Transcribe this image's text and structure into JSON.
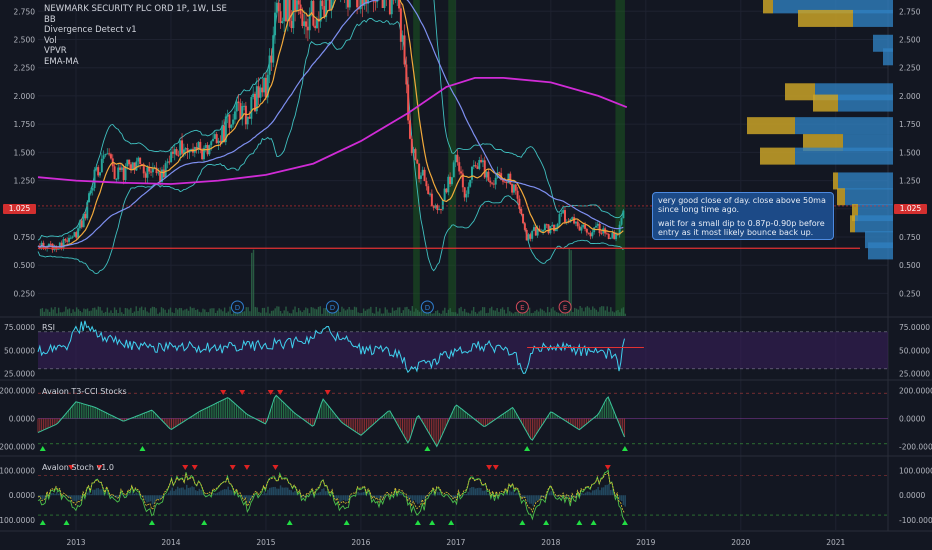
{
  "legend": {
    "symbol": "NEWMARK SECURITY PLC ORD 1P, 1W, LSE",
    "indicators": [
      "BB",
      "Divergence Detect v1",
      "Vol",
      "VPVR",
      "EMA-MA"
    ]
  },
  "annotation": {
    "line1": "very good close of day. close above 50ma since long time ago.",
    "line2": "wait for a small dip to 0.87p-0.90p before entry as it most likely bounce back up."
  },
  "current_price_label": "1.025",
  "colors": {
    "background": "#131722",
    "candle_up": "#26a69a",
    "candle_down": "#ef5350",
    "ma200": "#d02bd6",
    "ema_orange": "#f2a93b",
    "ma_blue": "#7e8ff0",
    "bollinger": "#3fbfbf",
    "support_line": "#e23232",
    "rsi_line": "#3fd0ee",
    "vpvr_up": "#2f7fbf",
    "vpvr_down": "#c9a227"
  },
  "panes": {
    "rsi_label": "RSI",
    "cci_label": "Avalon T3-CCI Stocks",
    "stoch_label": "Avalon Stoch v1.0"
  },
  "chart_data": [
    {
      "type": "candlestick",
      "title": "NEWMARK SECURITY PLC ORD 1P, 1W, LSE",
      "x_axis": {
        "tick_labels": [
          "2013",
          "2014",
          "2015",
          "2016",
          "2017",
          "2018",
          "2019",
          "2020",
          "2021"
        ]
      },
      "y_axis": {
        "tick_labels": [
          "0.250",
          "0.500",
          "0.750",
          "1.000",
          "1.250",
          "1.500",
          "1.750",
          "2.000",
          "2.250",
          "2.500",
          "2.750"
        ],
        "range": [
          0.05,
          2.85
        ]
      },
      "current_price": 1.025,
      "support_level": 0.65,
      "price_path": {
        "x": [
          2012.6,
          2012.75,
          2012.9,
          2013.0,
          2013.1,
          2013.2,
          2013.3,
          2013.45,
          2013.6,
          2013.75,
          2013.9,
          2014.0,
          2014.1,
          2014.2,
          2014.35,
          2014.5,
          2014.6,
          2014.7,
          2014.8,
          2014.9,
          2015.0,
          2015.05,
          2015.1,
          2015.2,
          2015.3,
          2015.4,
          2015.5,
          2015.6,
          2015.7,
          2015.8,
          2015.9,
          2016.0,
          2016.1,
          2016.2,
          2016.3,
          2016.4,
          2016.45,
          2016.5,
          2016.6,
          2016.7,
          2016.8,
          2016.9,
          2017.0,
          2017.1,
          2017.2,
          2017.3,
          2017.4,
          2017.5,
          2017.6,
          2017.7,
          2017.75,
          2017.8,
          2017.9,
          2018.0,
          2018.1,
          2018.2,
          2018.3,
          2018.4,
          2018.5,
          2018.6,
          2018.7,
          2018.78
        ],
        "y": [
          0.68,
          0.66,
          0.7,
          0.78,
          0.95,
          1.3,
          1.45,
          1.3,
          1.4,
          1.35,
          1.3,
          1.5,
          1.55,
          1.48,
          1.52,
          1.6,
          1.75,
          1.85,
          1.8,
          2.0,
          2.05,
          2.3,
          2.7,
          2.8,
          2.75,
          2.6,
          2.75,
          2.8,
          2.95,
          3.0,
          2.9,
          2.95,
          3.0,
          2.95,
          2.85,
          2.75,
          2.4,
          1.7,
          1.35,
          1.2,
          0.95,
          1.15,
          1.5,
          1.1,
          1.4,
          1.35,
          1.25,
          1.3,
          1.2,
          0.9,
          0.75,
          0.78,
          0.85,
          0.8,
          0.95,
          0.9,
          0.85,
          0.8,
          0.82,
          0.78,
          0.75,
          1.025
        ]
      },
      "ma200": {
        "x": [
          2012.6,
          2013.0,
          2013.5,
          2014.0,
          2014.5,
          2015.0,
          2015.5,
          2016.0,
          2016.5,
          2016.9,
          2017.2,
          2017.5,
          2018.0,
          2018.5,
          2018.8
        ],
        "y": [
          1.28,
          1.25,
          1.23,
          1.22,
          1.25,
          1.3,
          1.4,
          1.6,
          1.85,
          2.08,
          2.16,
          2.16,
          2.12,
          2.0,
          1.9
        ]
      },
      "divergence_markers": [
        {
          "label": "D",
          "x": 2014.7
        },
        {
          "label": "D",
          "x": 2015.7
        },
        {
          "label": "D",
          "x": 2016.7
        },
        {
          "label": "E",
          "x": 2017.7
        },
        {
          "label": "E",
          "x": 2018.15
        }
      ]
    },
    {
      "type": "line",
      "title": "RSI",
      "y_axis": {
        "tick_labels": [
          "25.0000",
          "50.0000",
          "75.0000"
        ],
        "range": [
          20,
          85
        ]
      },
      "bands": [
        30,
        70
      ],
      "x": [
        2012.6,
        2012.9,
        2013.0,
        2013.1,
        2013.3,
        2013.5,
        2013.8,
        2014.0,
        2014.5,
        2015.0,
        2015.3,
        2015.5,
        2015.6,
        2016.0,
        2016.4,
        2016.5,
        2016.7,
        2016.9,
        2017.0,
        2017.3,
        2017.6,
        2017.7,
        2017.75,
        2017.8,
        2018.0,
        2018.3,
        2018.5,
        2018.7,
        2018.72,
        2018.78
      ],
      "y": [
        50,
        52,
        72,
        78,
        65,
        58,
        52,
        55,
        52,
        56,
        58,
        62,
        75,
        50,
        48,
        30,
        35,
        45,
        50,
        55,
        50,
        28,
        32,
        50,
        55,
        50,
        48,
        45,
        30,
        72
      ]
    },
    {
      "type": "line",
      "title": "Avalon T3-CCI Stocks",
      "y_axis": {
        "tick_labels": [
          "-200.0000",
          "0.0000",
          "200.0000"
        ],
        "range": [
          -260,
          260
        ]
      },
      "x": [
        2012.6,
        2012.8,
        2013.0,
        2013.2,
        2013.5,
        2013.8,
        2014.0,
        2014.3,
        2014.6,
        2014.8,
        2015.0,
        2015.1,
        2015.3,
        2015.5,
        2015.6,
        2015.8,
        2016.0,
        2016.3,
        2016.5,
        2016.6,
        2016.8,
        2017.0,
        2017.3,
        2017.6,
        2017.8,
        2018.0,
        2018.3,
        2018.5,
        2018.6,
        2018.78
      ],
      "y": [
        -100,
        -40,
        120,
        80,
        -20,
        60,
        -80,
        50,
        150,
        30,
        -40,
        170,
        40,
        -60,
        140,
        -30,
        -120,
        60,
        -180,
        30,
        -200,
        100,
        -60,
        80,
        -160,
        50,
        -80,
        30,
        160,
        -140
      ]
    },
    {
      "type": "line",
      "title": "Avalon Stoch v1.0",
      "y_axis": {
        "tick_labels": [
          "-100.0000",
          "0.0000",
          "100.0000"
        ],
        "range": [
          -140,
          150
        ]
      },
      "x": [
        2012.6,
        2012.8,
        2013.0,
        2013.2,
        2013.4,
        2013.6,
        2013.8,
        2014.0,
        2014.2,
        2014.4,
        2014.6,
        2014.8,
        2015.0,
        2015.2,
        2015.4,
        2015.6,
        2015.8,
        2016.0,
        2016.2,
        2016.4,
        2016.6,
        2016.8,
        2017.0,
        2017.2,
        2017.4,
        2017.6,
        2017.8,
        2018.0,
        2018.2,
        2018.4,
        2018.6,
        2018.78
      ],
      "y": [
        -40,
        20,
        -60,
        60,
        -20,
        30,
        -80,
        50,
        80,
        -10,
        60,
        -50,
        40,
        90,
        -30,
        50,
        -60,
        30,
        -40,
        20,
        -80,
        30,
        -20,
        80,
        -10,
        40,
        -90,
        20,
        -30,
        30,
        90,
        -110
      ]
    }
  ]
}
